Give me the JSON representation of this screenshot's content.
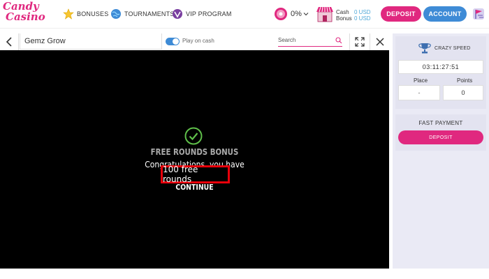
{
  "header": {
    "logo_line1": "Candy",
    "logo_line2": "Casino",
    "nav": [
      {
        "label": "BONUSES",
        "icon": "star-icon"
      },
      {
        "label": "TOURNAMENTS",
        "icon": "globe-icon"
      },
      {
        "label": "VIP PROGRAM",
        "icon": "vip-icon"
      }
    ],
    "bonus_progress": "0%",
    "wallet": {
      "cash_label": "Cash",
      "bonus_label": "Bonus",
      "cash_value": "0 USD",
      "bonus_value": "0 USD"
    },
    "deposit_label": "DEPOSIT",
    "account_label": "ACCOUNT"
  },
  "game": {
    "title": "Gemz Grow",
    "play_mode_label": "Play on cash",
    "search_placeholder": "Search",
    "bonus_title": "FREE ROUNDS BONUS",
    "bonus_message": "Congratulations, you have",
    "rounds_text": "100 free rounds",
    "continue_label": "CONTINUE"
  },
  "sidebar": {
    "tournament_name": "CRAZY SPEED",
    "timer": "03:11:27:51",
    "place_label": "Place",
    "points_label": "Points",
    "place_value": "-",
    "points_value": "0",
    "fast_payment_title": "FAST PAYMENT",
    "fast_deposit_label": "DEPOSIT"
  },
  "colors": {
    "brand_pink": "#e0287f",
    "brand_blue": "#3e8bd6",
    "highlight_red": "#e8000a"
  }
}
